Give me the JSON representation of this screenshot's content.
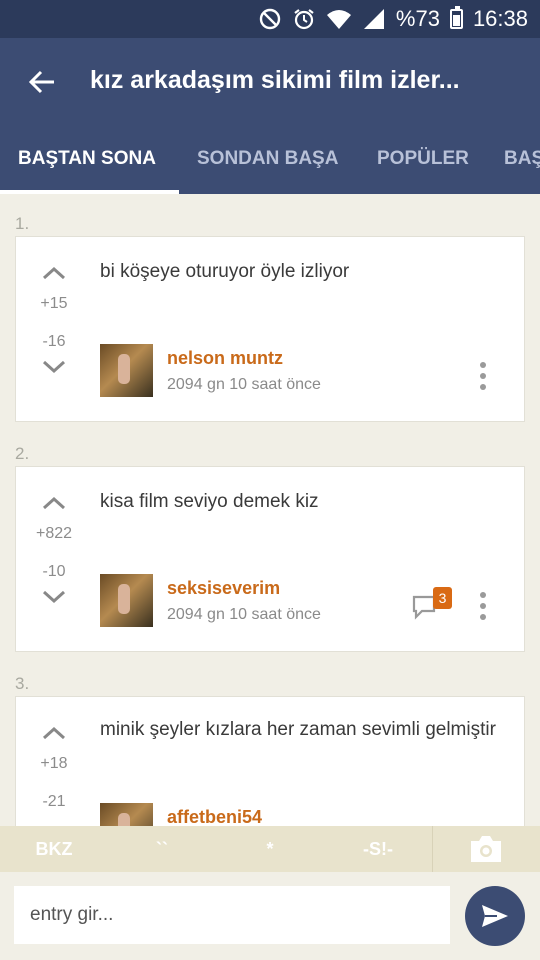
{
  "status_bar": {
    "battery_percent": "%73",
    "time": "16:38",
    "icons": [
      "do-not-disturb-icon",
      "alarm-icon",
      "wifi-icon",
      "signal-icon",
      "battery-icon"
    ]
  },
  "header": {
    "title": "kız arkadaşım sikimi film izler...",
    "tabs": [
      {
        "label": "BAŞTAN SONA",
        "active": true
      },
      {
        "label": "SONDAN BAŞA",
        "active": false
      },
      {
        "label": "POPÜLER",
        "active": false
      },
      {
        "label": "BAŞ",
        "active": false
      }
    ]
  },
  "entries": [
    {
      "number": "1.",
      "text": "bi köşeye oturuyor öyle izliyor",
      "upvotes": "+15",
      "downvotes": "-16",
      "author": "nelson muntz",
      "time_ago": "2094 gn 10 saat  önce",
      "comment_count": null
    },
    {
      "number": "2.",
      "text": "kisa film seviyo demek kiz",
      "upvotes": "+822",
      "downvotes": "-10",
      "author": "seksiseverim",
      "time_ago": "2094 gn 10 saat  önce",
      "comment_count": "3"
    },
    {
      "number": "3.",
      "text": "minik şeyler kızlara her zaman sevimli gelmiştir",
      "upvotes": "+18",
      "downvotes": "-21",
      "author": "affetbeni54",
      "time_ago": "",
      "comment_count": null
    }
  ],
  "toolbar": {
    "bkz": "BKZ",
    "backtick": "``",
    "star": "*",
    "spoiler": "-S!-"
  },
  "composer": {
    "placeholder": "entry gir..."
  },
  "colors": {
    "header": "#3c4c73",
    "status_bar": "#2c3a5b",
    "author": "#c96a1a",
    "badge": "#d96a14",
    "background": "#f1efe6"
  }
}
